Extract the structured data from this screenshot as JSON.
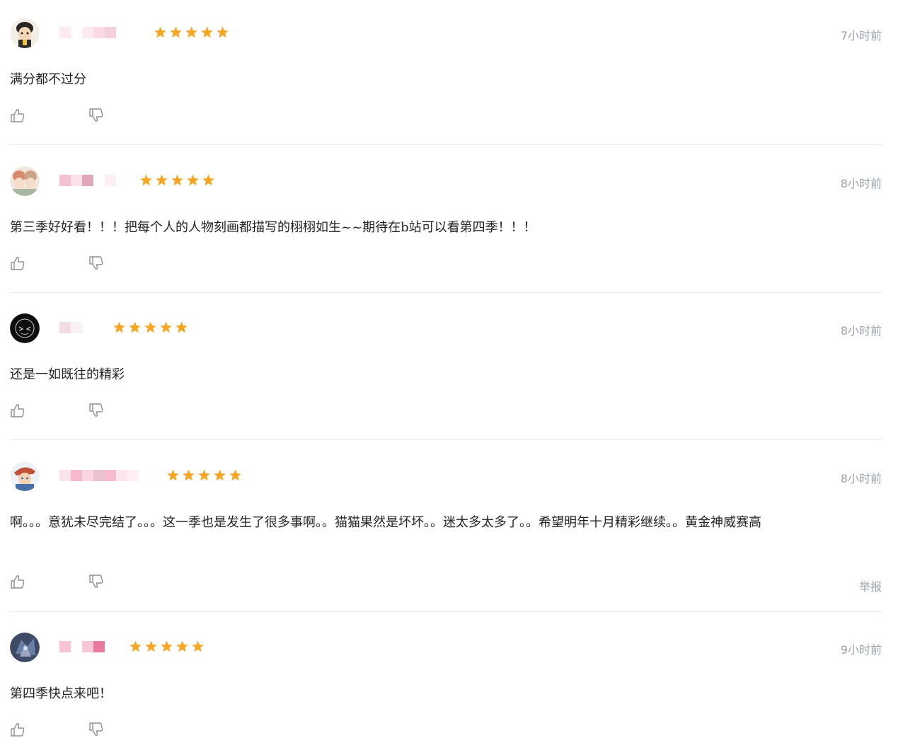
{
  "reviews": [
    {
      "avatar": "avatar-cartoon-boy",
      "username_pixels": [
        "#fbeaf0",
        "#ffffff",
        "#fde9f0",
        "#fadbe5",
        "#f5d0dc"
      ],
      "rating": 5,
      "time": "7小时前",
      "content": "满分都不过分",
      "show_report": false
    },
    {
      "avatar": "avatar-anime-girls",
      "username_pixels": [
        "#f3c1d1",
        "#fbe0ea",
        "#e1a6b7",
        "#ffffff",
        "#fdf0f4"
      ],
      "rating": 5,
      "time": "8小时前",
      "content": "第三季好好看！！！把每个人的人物刻画都描写的栩栩如生~~期待在b站可以看第四季！！！",
      "show_report": false
    },
    {
      "avatar": "avatar-dark-character",
      "username_pixels": [
        "#f3dce3",
        "#f8f1f3"
      ],
      "rating": 5,
      "time": "8小时前",
      "content": "还是一如既往的精彩",
      "show_report": false
    },
    {
      "avatar": "avatar-hat-character",
      "username_pixels": [
        "#fbe3ec",
        "#f5b8cc",
        "#f9d5e1",
        "#e9c2cf",
        "#f6bcce",
        "#fbe6ee",
        "#fdeff4"
      ],
      "rating": 5,
      "time": "8小时前",
      "content": "啊。。。意犹未尽完结了。。。这一季也是发生了很多事啊。。猫猫果然是坏坏。。迷太多太多了。。希望明年十月精彩继续。。黄金神威赛高",
      "show_report": true,
      "report_label": "举报"
    },
    {
      "avatar": "avatar-mecha",
      "username_pixels": [
        "#f7c3d5",
        "#ffffff",
        "#f8c7d7",
        "#e97a9f"
      ],
      "rating": 5,
      "time": "9小时前",
      "content": "第四季快点来吧！",
      "show_report": false
    }
  ],
  "icons": {
    "like": "thumbs-up-icon",
    "dislike": "thumbs-down-icon",
    "star": "star-icon"
  },
  "colors": {
    "star": "#f5a623",
    "meta_text": "#99a2aa",
    "divider": "#ececec",
    "icon": "#8a9098"
  }
}
